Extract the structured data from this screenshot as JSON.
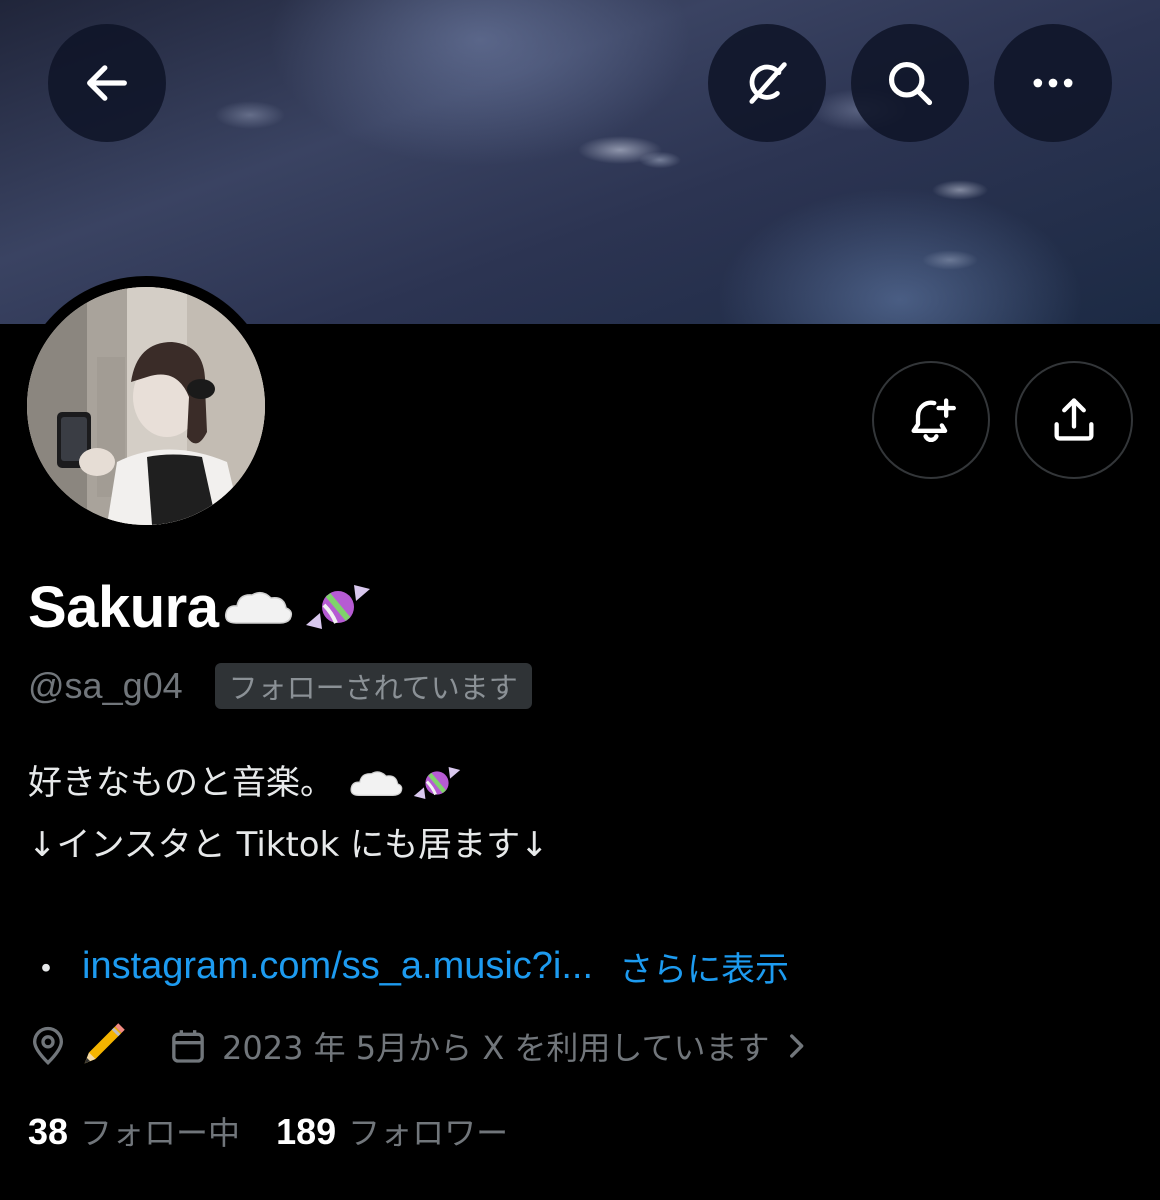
{
  "header": {
    "back_label": "Back",
    "grok_label": "Grok",
    "search_label": "Search",
    "more_label": "More"
  },
  "profile": {
    "display_name": "Sakura",
    "name_emojis": [
      "cloud",
      "candy"
    ],
    "handle": "@sa_g04",
    "follows_you": "フォローされています",
    "bio_line1": "好きなものと音楽。",
    "bio_line2": "↓インスタと Tiktok にも居ます↓",
    "link_bullet": "・",
    "link_text": "instagram.com/ss_a.music?i...",
    "show_more": "さらに表示",
    "joined": "2023 年 5月から X を利用しています",
    "following_count": "38",
    "following_label": "フォロー中",
    "followers_count": "189",
    "followers_label": "フォロワー"
  },
  "icons": {
    "back": "arrow-left-icon",
    "grok": "grok-icon",
    "search": "search-icon",
    "more": "more-horizontal-icon",
    "notify": "bell-plus-icon",
    "share": "share-icon",
    "location": "location-pin-icon",
    "pencil": "pencil-icon",
    "calendar": "calendar-icon",
    "chevron": "chevron-right-icon"
  },
  "colors": {
    "accent": "#1d9bf0",
    "secondary_text": "#71767b",
    "background": "#000000"
  }
}
